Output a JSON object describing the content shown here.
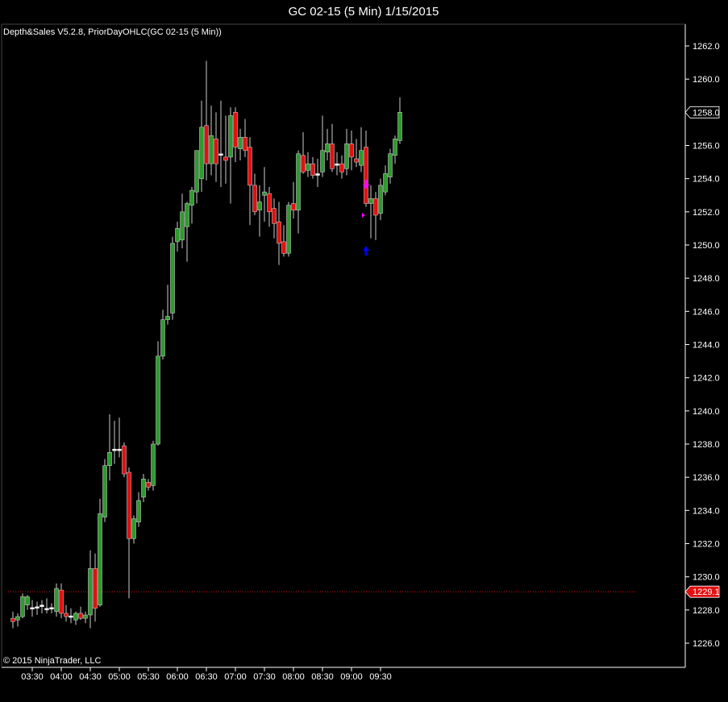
{
  "window": {
    "title": "GC 02-15 (5 Min)  1/15/2015"
  },
  "indicators_label": "Depth&Sales V5.2.8, PriorDayOHLC(GC 02-15 (5 Min))",
  "copyright": "© 2015 NinjaTrader, LLC",
  "chart_data": {
    "type": "candlestick",
    "title": "GC 02-15 (5 Min)  1/15/2015",
    "ylim": [
      1225.0,
      1263.5
    ],
    "yticks": [
      1226.0,
      1228.0,
      1230.0,
      1232.0,
      1234.0,
      1236.0,
      1238.0,
      1240.0,
      1242.0,
      1244.0,
      1246.0,
      1248.0,
      1250.0,
      1252.0,
      1254.0,
      1256.0,
      1258.0,
      1260.0,
      1262.0
    ],
    "ytick_labels": [
      "1226.0",
      "1228.0",
      "1230.0",
      "1232.0",
      "1234.0",
      "1236.0",
      "1238.0",
      "1240.0",
      "1242.0",
      "1244.0",
      "1246.0",
      "1248.0",
      "1250.0",
      "1252.0",
      "1254.0",
      "1256.0",
      "1258.0",
      "1260.0",
      "1262.0"
    ],
    "xticks": [
      "03:30",
      "04:00",
      "04:30",
      "05:00",
      "05:30",
      "06:00",
      "06:30",
      "07:00",
      "07:30",
      "08:00",
      "08:30",
      "09:00",
      "09:30"
    ],
    "xtick_bar_index": [
      4,
      10,
      16,
      22,
      28,
      34,
      40,
      46,
      52,
      58,
      64,
      70,
      76
    ],
    "grid": false,
    "last_price_label": "1258.0",
    "last_price": 1258.0,
    "prior_day_level_label": "1229.1",
    "prior_day_level": 1229.1,
    "colors": {
      "up": "#2e9a2e",
      "down": "#e31010",
      "doji": "#ffffff",
      "wick": "#cccccc",
      "background": "#000000",
      "axis": "#ffffff",
      "prior_day_line": "#e31010",
      "marker_magenta": "#ff00ff",
      "marker_blue": "#0000ff"
    },
    "candles": [
      {
        "o": 1227.5,
        "h": 1227.9,
        "l": 1226.9,
        "c": 1227.3
      },
      {
        "o": 1227.4,
        "h": 1227.8,
        "l": 1227.0,
        "c": 1227.6
      },
      {
        "o": 1227.6,
        "h": 1229.0,
        "l": 1227.5,
        "c": 1228.8
      },
      {
        "o": 1228.3,
        "h": 1228.9,
        "l": 1228.0,
        "c": 1228.8
      },
      {
        "o": 1228.1,
        "h": 1228.6,
        "l": 1227.6,
        "c": 1228.1
      },
      {
        "o": 1228.1,
        "h": 1228.5,
        "l": 1227.7,
        "c": 1228.2
      },
      {
        "o": 1228.2,
        "h": 1228.6,
        "l": 1227.8,
        "c": 1228.3
      },
      {
        "o": 1228.1,
        "h": 1228.7,
        "l": 1227.8,
        "c": 1228.0
      },
      {
        "o": 1228.1,
        "h": 1228.4,
        "l": 1227.8,
        "c": 1228.1
      },
      {
        "o": 1227.9,
        "h": 1229.6,
        "l": 1227.6,
        "c": 1229.3
      },
      {
        "o": 1229.2,
        "h": 1229.6,
        "l": 1227.5,
        "c": 1227.8
      },
      {
        "o": 1227.8,
        "h": 1228.3,
        "l": 1227.3,
        "c": 1227.6
      },
      {
        "o": 1227.6,
        "h": 1228.1,
        "l": 1227.2,
        "c": 1227.6
      },
      {
        "o": 1227.4,
        "h": 1227.9,
        "l": 1227.1,
        "c": 1227.8
      },
      {
        "o": 1227.8,
        "h": 1228.2,
        "l": 1227.4,
        "c": 1227.5
      },
      {
        "o": 1227.5,
        "h": 1227.9,
        "l": 1227.2,
        "c": 1227.7
      },
      {
        "o": 1227.7,
        "h": 1231.6,
        "l": 1226.9,
        "c": 1230.5
      },
      {
        "o": 1230.5,
        "h": 1231.4,
        "l": 1227.3,
        "c": 1228.1
      },
      {
        "o": 1228.3,
        "h": 1234.7,
        "l": 1228.2,
        "c": 1233.8
      },
      {
        "o": 1233.6,
        "h": 1237.1,
        "l": 1233.3,
        "c": 1236.7
      },
      {
        "o": 1236.7,
        "h": 1239.8,
        "l": 1235.8,
        "c": 1237.5
      },
      {
        "o": 1237.6,
        "h": 1239.4,
        "l": 1236.8,
        "c": 1237.7
      },
      {
        "o": 1237.6,
        "h": 1239.6,
        "l": 1237.2,
        "c": 1237.7
      },
      {
        "o": 1237.9,
        "h": 1238.1,
        "l": 1236.0,
        "c": 1236.2
      },
      {
        "o": 1236.3,
        "h": 1236.6,
        "l": 1228.7,
        "c": 1232.3
      },
      {
        "o": 1232.3,
        "h": 1233.7,
        "l": 1232.0,
        "c": 1233.5
      },
      {
        "o": 1233.3,
        "h": 1235.1,
        "l": 1233.0,
        "c": 1234.6
      },
      {
        "o": 1234.8,
        "h": 1236.2,
        "l": 1234.5,
        "c": 1235.9
      },
      {
        "o": 1235.7,
        "h": 1235.9,
        "l": 1235.2,
        "c": 1235.4
      },
      {
        "o": 1235.5,
        "h": 1238.2,
        "l": 1235.2,
        "c": 1238.0
      },
      {
        "o": 1238.0,
        "h": 1244.2,
        "l": 1237.9,
        "c": 1243.3
      },
      {
        "o": 1243.3,
        "h": 1246.1,
        "l": 1243.1,
        "c": 1245.5
      },
      {
        "o": 1245.5,
        "h": 1247.6,
        "l": 1245.2,
        "c": 1245.7
      },
      {
        "o": 1245.9,
        "h": 1250.5,
        "l": 1245.5,
        "c": 1250.1
      },
      {
        "o": 1250.2,
        "h": 1251.4,
        "l": 1249.6,
        "c": 1251.0
      },
      {
        "o": 1250.3,
        "h": 1253.1,
        "l": 1249.8,
        "c": 1252.0
      },
      {
        "o": 1251.1,
        "h": 1252.6,
        "l": 1249.0,
        "c": 1252.5
      },
      {
        "o": 1252.4,
        "h": 1253.5,
        "l": 1251.3,
        "c": 1253.3
      },
      {
        "o": 1253.2,
        "h": 1255.6,
        "l": 1252.5,
        "c": 1255.7
      },
      {
        "o": 1254.0,
        "h": 1258.7,
        "l": 1253.2,
        "c": 1257.1
      },
      {
        "o": 1257.2,
        "h": 1261.1,
        "l": 1253.9,
        "c": 1254.9
      },
      {
        "o": 1254.9,
        "h": 1258.4,
        "l": 1254.2,
        "c": 1256.6
      },
      {
        "o": 1256.4,
        "h": 1258.0,
        "l": 1253.8,
        "c": 1254.9
      },
      {
        "o": 1255.4,
        "h": 1258.7,
        "l": 1253.5,
        "c": 1255.5
      },
      {
        "o": 1255.3,
        "h": 1257.8,
        "l": 1253.7,
        "c": 1255.1
      },
      {
        "o": 1255.3,
        "h": 1258.3,
        "l": 1252.5,
        "c": 1257.8
      },
      {
        "o": 1258.0,
        "h": 1258.3,
        "l": 1255.0,
        "c": 1255.9
      },
      {
        "o": 1255.8,
        "h": 1257.0,
        "l": 1255.1,
        "c": 1256.5
      },
      {
        "o": 1256.5,
        "h": 1257.6,
        "l": 1255.3,
        "c": 1255.7
      },
      {
        "o": 1255.9,
        "h": 1256.5,
        "l": 1251.2,
        "c": 1253.6
      },
      {
        "o": 1253.6,
        "h": 1254.3,
        "l": 1251.8,
        "c": 1252.0
      },
      {
        "o": 1252.1,
        "h": 1253.6,
        "l": 1250.5,
        "c": 1252.6
      },
      {
        "o": 1253.0,
        "h": 1254.7,
        "l": 1251.4,
        "c": 1253.2
      },
      {
        "o": 1253.1,
        "h": 1253.5,
        "l": 1251.1,
        "c": 1252.0
      },
      {
        "o": 1252.2,
        "h": 1252.8,
        "l": 1250.4,
        "c": 1251.3
      },
      {
        "o": 1251.4,
        "h": 1252.6,
        "l": 1248.8,
        "c": 1250.1
      },
      {
        "o": 1250.2,
        "h": 1251.2,
        "l": 1249.3,
        "c": 1249.5
      },
      {
        "o": 1249.5,
        "h": 1252.6,
        "l": 1249.3,
        "c": 1252.4
      },
      {
        "o": 1252.5,
        "h": 1253.8,
        "l": 1251.6,
        "c": 1252.1
      },
      {
        "o": 1252.1,
        "h": 1255.7,
        "l": 1250.7,
        "c": 1255.5
      },
      {
        "o": 1255.4,
        "h": 1256.8,
        "l": 1254.3,
        "c": 1254.4
      },
      {
        "o": 1254.5,
        "h": 1255.6,
        "l": 1254.1,
        "c": 1254.9
      },
      {
        "o": 1254.9,
        "h": 1255.3,
        "l": 1254.0,
        "c": 1254.2
      },
      {
        "o": 1254.2,
        "h": 1255.2,
        "l": 1253.5,
        "c": 1254.3
      },
      {
        "o": 1254.4,
        "h": 1257.8,
        "l": 1254.1,
        "c": 1255.7
      },
      {
        "o": 1255.6,
        "h": 1257.0,
        "l": 1255.1,
        "c": 1256.1
      },
      {
        "o": 1256.1,
        "h": 1257.3,
        "l": 1254.4,
        "c": 1254.6
      },
      {
        "o": 1254.9,
        "h": 1255.6,
        "l": 1254.2,
        "c": 1254.8
      },
      {
        "o": 1254.9,
        "h": 1255.4,
        "l": 1254.0,
        "c": 1254.4
      },
      {
        "o": 1254.6,
        "h": 1257.0,
        "l": 1254.2,
        "c": 1256.1
      },
      {
        "o": 1256.1,
        "h": 1256.9,
        "l": 1254.5,
        "c": 1255.3
      },
      {
        "o": 1255.2,
        "h": 1256.4,
        "l": 1254.7,
        "c": 1255.0
      },
      {
        "o": 1254.8,
        "h": 1257.1,
        "l": 1254.4,
        "c": 1255.7
      },
      {
        "o": 1255.9,
        "h": 1256.9,
        "l": 1252.3,
        "c": 1252.5
      },
      {
        "o": 1252.5,
        "h": 1253.6,
        "l": 1250.4,
        "c": 1252.8
      },
      {
        "o": 1252.8,
        "h": 1253.2,
        "l": 1250.3,
        "c": 1251.8
      },
      {
        "o": 1251.9,
        "h": 1254.0,
        "l": 1251.5,
        "c": 1253.6
      },
      {
        "o": 1253.2,
        "h": 1254.8,
        "l": 1253.0,
        "c": 1254.3
      },
      {
        "o": 1254.1,
        "h": 1255.8,
        "l": 1253.7,
        "c": 1255.5
      },
      {
        "o": 1255.4,
        "h": 1256.6,
        "l": 1254.9,
        "c": 1256.4
      },
      {
        "o": 1256.3,
        "h": 1258.9,
        "l": 1256.1,
        "c": 1258.0
      }
    ],
    "markers": [
      {
        "bar": 73,
        "price": 1253.5,
        "shape": "arrow-down",
        "color": "#ff00ff"
      },
      {
        "bar": 73,
        "price": 1251.8,
        "shape": "triangle-right",
        "color": "#ff00ff"
      },
      {
        "bar": 73,
        "price": 1249.8,
        "shape": "arrow-up",
        "color": "#0000ff"
      }
    ]
  }
}
